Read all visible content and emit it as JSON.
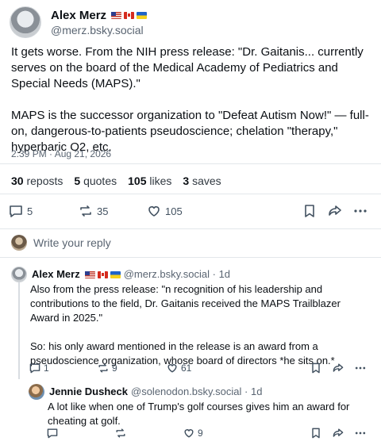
{
  "post": {
    "author_name": "Alex Merz",
    "handle": "@merz.bsky.social",
    "body": [
      "It gets worse. From the NIH press release: \"Dr. Gaitanis... currently serves on the board of the Medical Academy of Pediatrics and Special Needs (MAPS).\"",
      "MAPS is the successor organization to \"Defeat Autism Now!\" — full-on, dangerous-to-patients pseudoscience; chelation \"therapy,\" hyperbaric O2, etc."
    ],
    "timestamp": "2:39 PM · Aug 21, 2026",
    "stats": {
      "reposts_num": "30",
      "reposts_lbl": "reposts",
      "quotes_num": "5",
      "quotes_lbl": "quotes",
      "likes_num": "105",
      "likes_lbl": "likes",
      "saves_num": "3",
      "saves_lbl": "saves"
    },
    "actions": {
      "reply_count": "5",
      "repost_count": "35",
      "like_count": "105"
    },
    "icons": [
      "reply-icon",
      "repost-icon",
      "like-icon",
      "bookmark-icon",
      "share-icon",
      "more-icon"
    ]
  },
  "reply_prompt": {
    "placeholder": "Write your reply"
  },
  "replies": [
    {
      "author_name": "Alex Merz",
      "meta": "@merz.bsky.social · 1d",
      "body": [
        "Also from the press release: \"n recognition of his leadership and contributions to the field, Dr. Gaitanis received the MAPS Trailblazer Award in 2025.\"",
        "So: his only award mentioned in the release is an award from a pseudoscience organization, whose board of directors *he sits on.*"
      ],
      "reply_count": "1",
      "repost_count": "9",
      "like_count": "61"
    },
    {
      "author_name": "Jennie Dusheck",
      "meta": "@solenodon.bsky.social · 1d",
      "body": [
        "A lot like when one of Trump's golf courses gives him an award for cheating at golf."
      ],
      "reply_count": "",
      "repost_count": "",
      "like_count": "9"
    }
  ],
  "colors": {
    "text": "#0b0f14",
    "muted": "#5a6572",
    "divider": "#e3e7eb",
    "icon": "#425160"
  }
}
